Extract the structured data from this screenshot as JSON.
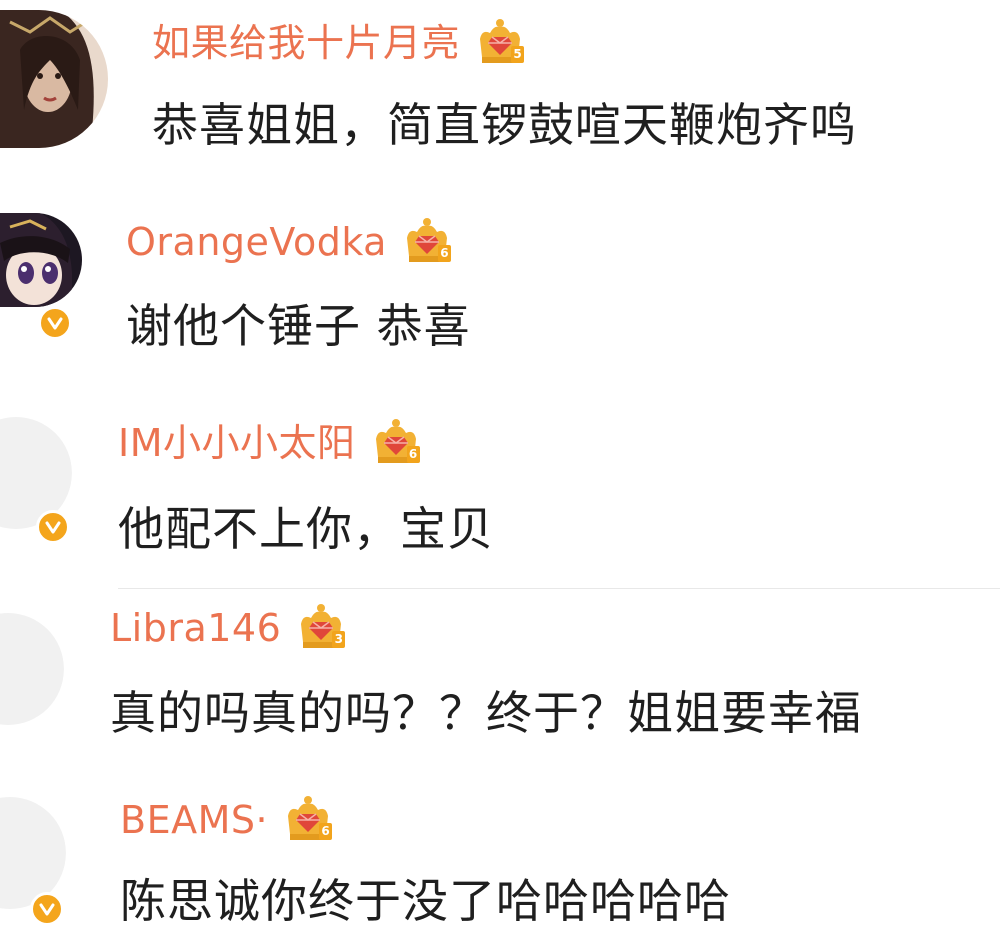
{
  "comments": [
    {
      "username": "如果给我十片月亮",
      "level": "5",
      "text": "恭喜姐姐，简直锣鼓喧天鞭炮齐鸣",
      "verified": false,
      "avatar": "portrait-woman-long-hair"
    },
    {
      "username": "OrangeVodka",
      "level": "6",
      "text": "谢他个锤子 恭喜",
      "verified": true,
      "avatar": "anime-girl"
    },
    {
      "username": "IM小小小太阳",
      "level": "6",
      "text": "他配不上你，宝贝",
      "verified": true,
      "avatar": "blank-light-avatar"
    },
    {
      "username": "Libra146",
      "level": "3",
      "text": "真的吗真的吗？？终于？姐姐要幸福",
      "verified": false,
      "avatar": "blank-light-avatar"
    },
    {
      "username": "BEAMS·",
      "level": "6",
      "text": "陈思诚你终于没了哈哈哈哈哈",
      "verified": true,
      "avatar": "blank-light-avatar"
    }
  ],
  "colors": {
    "username": "#eb7350",
    "text": "#1f1f1f",
    "verified_badge": "#f4a51c",
    "crown_gold": "#f2b134",
    "crown_gem": "#e0463a"
  }
}
